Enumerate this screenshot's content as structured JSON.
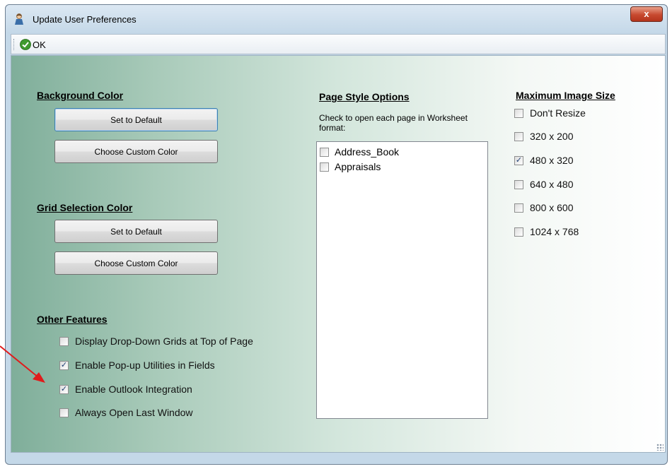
{
  "window": {
    "title": "Update User Preferences",
    "close_label": "x"
  },
  "toolbar": {
    "ok_label": "OK"
  },
  "background_color": {
    "heading": "Background Color",
    "default_label": "Set to Default",
    "custom_label": "Choose Custom Color"
  },
  "grid_selection_color": {
    "heading": "Grid Selection Color",
    "default_label": "Set to Default",
    "custom_label": "Choose Custom Color"
  },
  "other_features": {
    "heading": "Other Features",
    "items": [
      {
        "label": "Display Drop-Down Grids at Top of Page",
        "checked": false
      },
      {
        "label": "Enable Pop-up Utilities in Fields",
        "checked": true
      },
      {
        "label": "Enable Outlook Integration",
        "checked": true
      },
      {
        "label": "Always Open Last Window",
        "checked": false
      }
    ]
  },
  "page_style": {
    "heading": "Page Style Options",
    "description": "Check to open each page in Worksheet format:",
    "items": [
      {
        "label": "Address_Book",
        "checked": false
      },
      {
        "label": "Appraisals",
        "checked": false
      }
    ]
  },
  "image_size": {
    "heading": "Maximum Image Size",
    "items": [
      {
        "label": "Don't Resize",
        "checked": false
      },
      {
        "label": "320 x 200",
        "checked": false
      },
      {
        "label": "480 x 320",
        "checked": true
      },
      {
        "label": "640 x 480",
        "checked": false
      },
      {
        "label": "800 x 600",
        "checked": false
      },
      {
        "label": "1024 x 768",
        "checked": false
      }
    ]
  },
  "colors": {
    "annotation_arrow": "#e01b1b",
    "check_mark": "#1d3d72"
  }
}
